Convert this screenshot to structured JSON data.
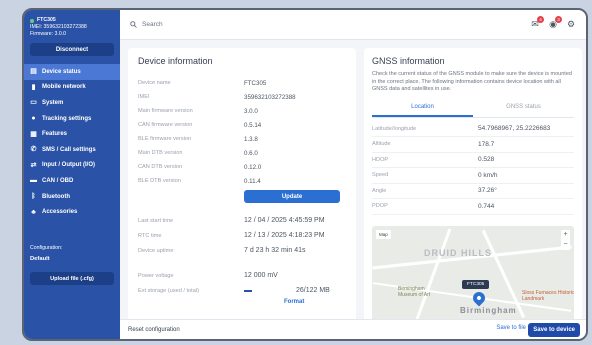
{
  "device": {
    "name": "FTC305",
    "imei_line": "IMEI: 359632103272388",
    "firmware_line": "Firmware: 3.0.0",
    "status_color": "#5fd17a"
  },
  "sidebar": {
    "disconnect": "Disconnect",
    "items": [
      {
        "label": "Device status",
        "icon": "status-icon"
      },
      {
        "label": "Mobile network",
        "icon": "signal-icon"
      },
      {
        "label": "System",
        "icon": "system-icon"
      },
      {
        "label": "Tracking settings",
        "icon": "location-icon"
      },
      {
        "label": "Features",
        "icon": "features-icon"
      },
      {
        "label": "SMS / Call settings",
        "icon": "phone-icon"
      },
      {
        "label": "Input / Output (I/O)",
        "icon": "io-icon"
      },
      {
        "label": "CAN / OBD",
        "icon": "can-icon"
      },
      {
        "label": "Bluetooth",
        "icon": "bluetooth-icon"
      },
      {
        "label": "Accessories",
        "icon": "accessories-icon"
      }
    ],
    "config_label": "Configuration:",
    "config_value": "Default",
    "upload": "Upload file (.cfg)"
  },
  "topbar": {
    "search_placeholder": "Search",
    "badge_1": "4",
    "badge_2": "3"
  },
  "device_info": {
    "title": "Device information",
    "rows": [
      {
        "k": "Device name",
        "v": "FTC305"
      },
      {
        "k": "IMEI",
        "v": "359632103272388"
      },
      {
        "k": "Main firmware version",
        "v": "3.0.0"
      },
      {
        "k": "CAN firmware version",
        "v": "0.5.14"
      },
      {
        "k": "BLE firmware version",
        "v": "1.3.8"
      },
      {
        "k": "Main DTB version",
        "v": "0.6.0"
      },
      {
        "k": "CAN DTB version",
        "v": "0.12.0"
      },
      {
        "k": "BLE DTB version",
        "v": "0.11.4"
      }
    ],
    "update": "Update",
    "rows2": [
      {
        "k": "Last start time",
        "v": "12 / 04 / 2025  4:45:59 PM"
      },
      {
        "k": "RTC time",
        "v": "12 / 13 / 2025  4:18:23 PM"
      },
      {
        "k": "Device uptime",
        "v": "7 d 23 h 32 min 41s"
      }
    ],
    "power_k": "Power voltage",
    "power_v": "12 000 mV",
    "storage_k": "Ext storage (used / total)",
    "storage_v": "26/122 MB",
    "storage_fraction": 0.21,
    "format": "Format"
  },
  "gnss": {
    "title": "GNSS information",
    "desc": "Check the current status of the GNSS module to make sure the device is mounted in the correct place. The following information contains device location with all GNSS data and satellites in use.",
    "tab_location": "Location",
    "tab_status": "GNSS status",
    "rows": [
      {
        "k": "Latitude/longitude",
        "v": "54.7968967, 25.2226683"
      },
      {
        "k": "Altitude",
        "v": "178.7"
      },
      {
        "k": "HDOP",
        "v": "0.528"
      },
      {
        "k": "Speed",
        "v": "0 km/h"
      },
      {
        "k": "Angle",
        "v": "37.26°"
      },
      {
        "k": "PDOP",
        "v": "0.744"
      }
    ],
    "map": {
      "type": "Map",
      "district": "DRUID HILLS",
      "city": "Birmingham",
      "museum": "Birmingham Museum of Art",
      "furnace": "Sloss Furnaces Historic Landmark",
      "pin_label": "FTC305"
    }
  },
  "footer": {
    "reset": "Reset configuration",
    "save_file": "Save to file",
    "save_device": "Save to device"
  }
}
